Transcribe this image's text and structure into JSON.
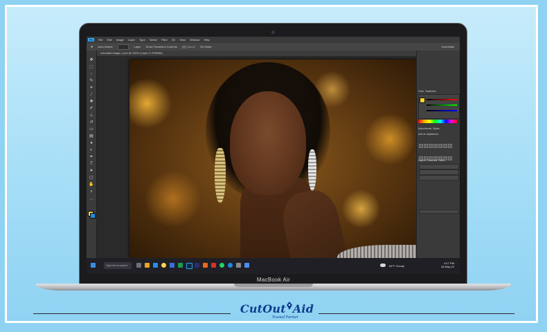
{
  "menubar": {
    "app_icon": "Ps",
    "items": [
      "File",
      "Edit",
      "Image",
      "Layer",
      "Type",
      "Select",
      "Filter",
      "3D",
      "View",
      "Window",
      "Help"
    ]
  },
  "optionsbar": {
    "auto_select": "Auto-Select:",
    "layer": "Layer",
    "show_transform": "Show Transform Controls",
    "mode_3d": "3D Mode:",
    "workspace": "Essentials"
  },
  "document_tab": {
    "title": "cutoutaid-image-1.psd @ 100% (Layer 0, RGB/8#)"
  },
  "panels": {
    "color_tab": "Color",
    "swatches_tab": "Swatches",
    "adjustments_tab": "Adjustments",
    "styles_tab": "Styles",
    "add_adjustment": "Add an adjustment",
    "layers_tab": "Layers",
    "channels_tab": "Channels",
    "paths_tab": "Paths"
  },
  "taskbar": {
    "search_placeholder": "Type here to search",
    "weather": "84°F Cloudy",
    "time": "4:17 PM",
    "date": "15-May-22"
  },
  "laptop": {
    "model_label": "MacBook Air"
  },
  "brand": {
    "name_left": "CutOut",
    "name_right": "Aid",
    "tagline": "Trusted Partner",
    "color": "#0e3d8f"
  },
  "colors": {
    "background": "#8fd2f2",
    "photoshop_accent": "#2fa3f7"
  }
}
